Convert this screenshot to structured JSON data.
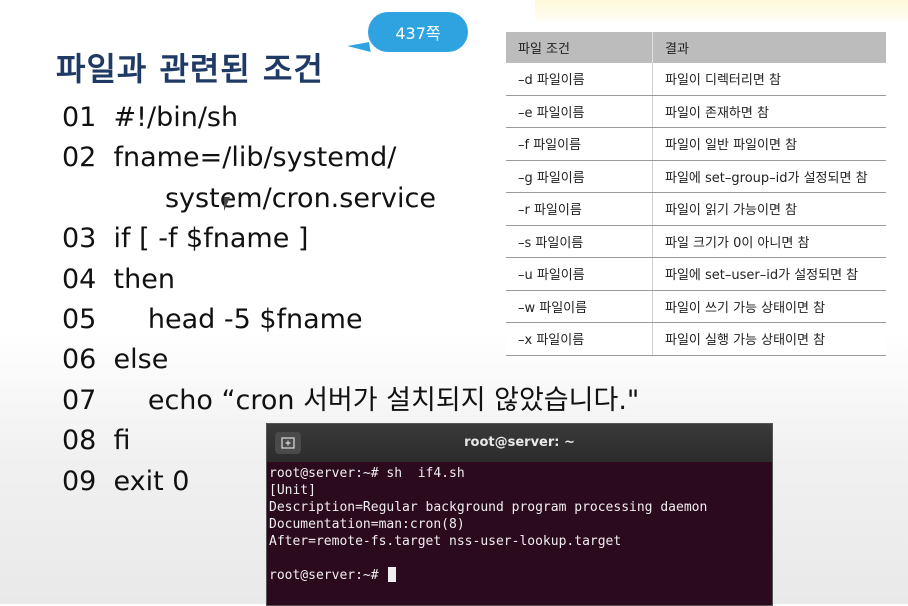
{
  "slide": {
    "title": "파일과 관련된 조건",
    "page_ref": "437쪽"
  },
  "code_lines": [
    "01  #!/bin/sh",
    "02  fname=/lib/systemd/",
    "            system/cron.service",
    "03  if [ -f $fname ]",
    "04  then",
    "05      head -5 $fname",
    "06  else",
    "07      echo “cron 서버가 설치되지 않았습니다.\"",
    "08  fi",
    "09  exit 0"
  ],
  "table": {
    "headers": [
      "파일 조건",
      "결과"
    ],
    "rows": [
      [
        "–d 파일이름",
        "파일이 디렉터리면 참"
      ],
      [
        "–e 파일이름",
        "파일이 존재하면 참"
      ],
      [
        "–f 파일이름",
        "파일이 일반 파일이면 참"
      ],
      [
        "–g 파일이름",
        "파일에 set–group–id가 설정되면 참"
      ],
      [
        "–r 파일이름",
        "파일이 읽기 가능이면 참"
      ],
      [
        "–s 파일이름",
        "파일 크기가 0이 아니면 참"
      ],
      [
        "–u 파일이름",
        "파일에 set–user–id가 설정되면 참"
      ],
      [
        "–w 파일이름",
        "파일이 쓰기 가능 상태이면 참"
      ],
      [
        "–x 파일이름",
        "파일이 실행 가능 상태이면 참"
      ]
    ]
  },
  "terminal": {
    "title": "root@server: ~",
    "new_tab_icon": "new-tab-icon",
    "lines": [
      "root@server:~# sh  if4.sh",
      "[Unit]",
      "Description=Regular background program processing daemon",
      "Documentation=man:cron(8)",
      "After=remote-fs.target nss-user-lookup.target",
      "",
      "root@server:~# "
    ]
  },
  "colors": {
    "title": "#1f3a64",
    "bubble": "#2fa3e0",
    "terminal_bg": "#2c0a1e",
    "table_header": "#bcbcbc"
  }
}
